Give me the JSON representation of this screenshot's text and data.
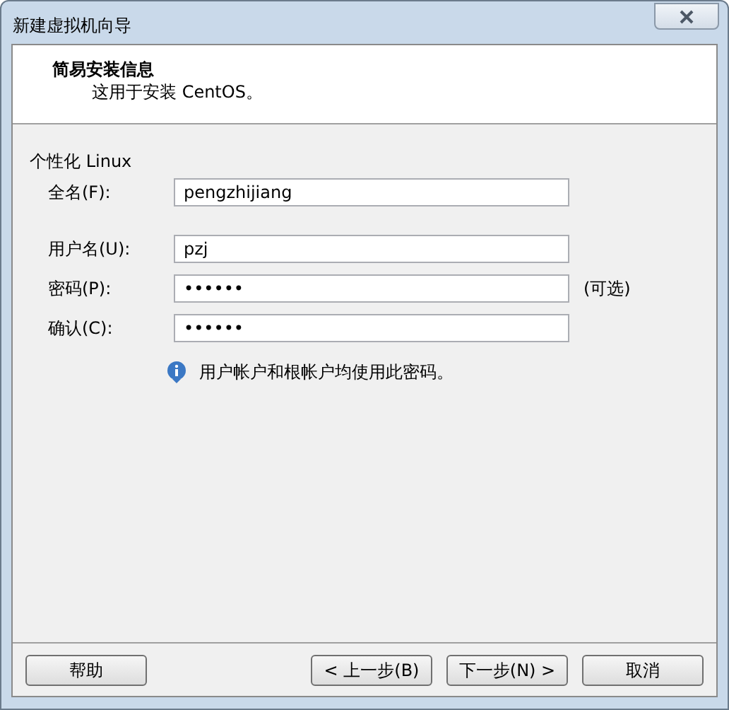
{
  "window": {
    "title": "新建虚拟机向导"
  },
  "header": {
    "title": "简易安装信息",
    "subtitle": "这用于安装 CentOS。"
  },
  "section": {
    "title": "个性化 Linux"
  },
  "fields": [
    {
      "label": "全名(F):",
      "value": "pengzhijiang"
    },
    {
      "label": "用户名(U):",
      "value": "pzj"
    },
    {
      "label": "密码(P):",
      "value": "••••••",
      "note": "(可选)"
    },
    {
      "label": "确认(C):",
      "value": "••••••"
    }
  ],
  "info": "用户帐户和根帐户均使用此密码。",
  "buttons": {
    "help": "帮助",
    "back": "< 上一步(B)",
    "next": "下一步(N) >",
    "cancel": "取消"
  }
}
